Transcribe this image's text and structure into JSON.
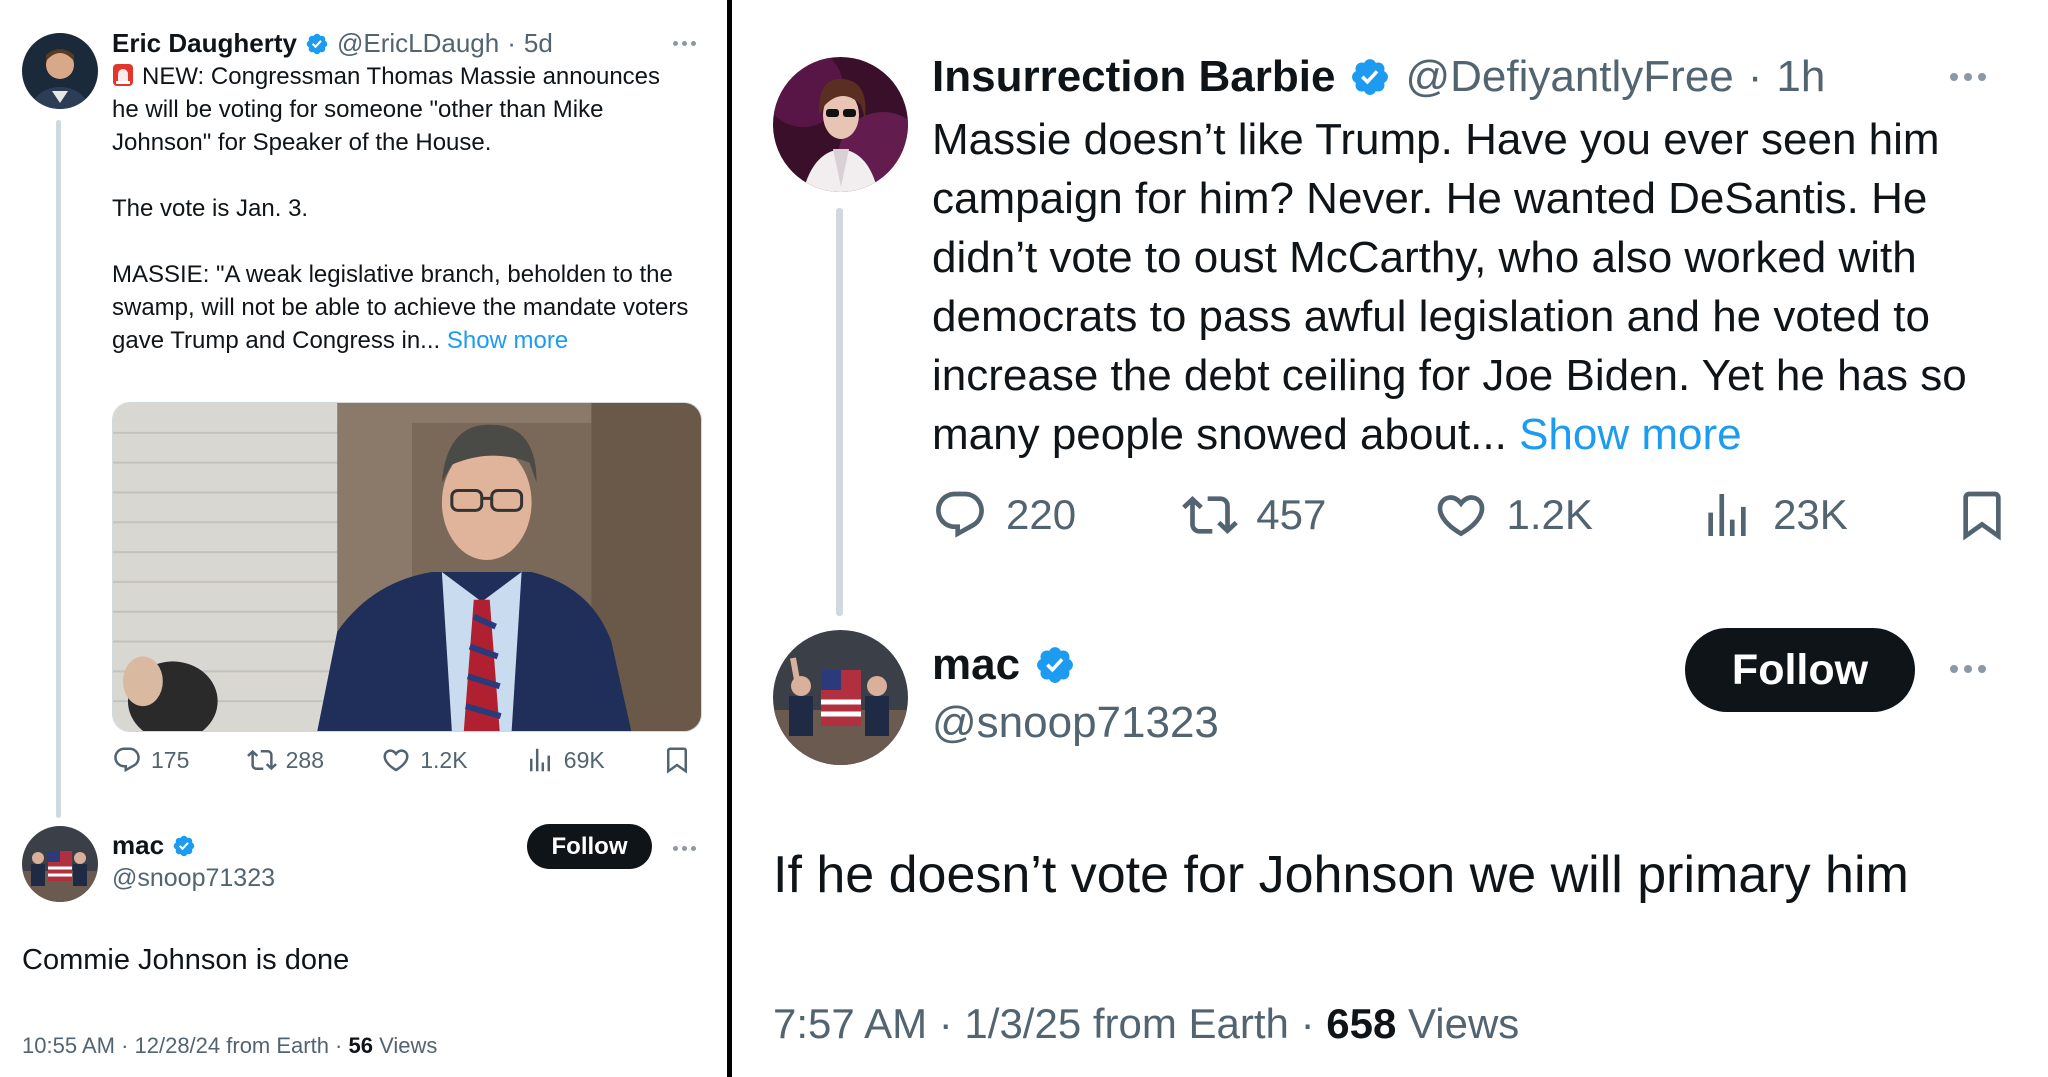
{
  "left": {
    "tweet": {
      "author_name": "Eric Daugherty",
      "author_handle": "@EricLDaugh",
      "time": "5d",
      "text_lines": [
        "NEW: Congressman Thomas Massie announces he will be voting for someone \"other than Mike Johnson\" for Speaker of the House.",
        "The vote is Jan. 3.",
        "MASSIE: \"A weak legislative branch, beholden to the swamp, will not be able to achieve the mandate voters gave Trump and Congress in..."
      ],
      "show_more": "Show more",
      "stats": {
        "replies": "175",
        "reposts": "288",
        "likes": "1.2K",
        "views": "69K"
      }
    },
    "reply": {
      "author_name": "mac",
      "author_handle": "@snoop71323",
      "follow_label": "Follow",
      "text": "Commie Johnson is done",
      "meta_prefix": "10:55 AM · 12/28/24 from Earth · ",
      "views_count": "56",
      "views_label": " Views"
    }
  },
  "right": {
    "tweet": {
      "author_name": "Insurrection Barbie",
      "author_handle": "@DefiyantlyFree",
      "time": "1h",
      "text": "Massie doesn’t like Trump. Have you ever seen him campaign for him? Never. He wanted DeSantis. He didn’t vote to oust McCarthy, who also worked with democrats to pass awful legislation and he voted to increase the debt ceiling for Joe Biden. Yet he has so many people snowed about...",
      "show_more": "Show more",
      "stats": {
        "replies": "220",
        "reposts": "457",
        "likes": "1.2K",
        "views": "23K"
      }
    },
    "reply": {
      "author_name": "mac",
      "author_handle": "@snoop71323",
      "follow_label": "Follow",
      "text": "If he doesn’t vote for Johnson we will primary him",
      "meta_prefix": "7:57 AM · 1/3/25 from Earth · ",
      "views_count": "658",
      "views_label": " Views"
    }
  },
  "colors": {
    "link": "#1d9bf0",
    "verified": "#1d9bf0",
    "muted_text": "#536471",
    "follow_bg": "#0f1419",
    "divider": "#000000"
  },
  "icons": [
    "reply-icon",
    "repost-icon",
    "like-icon",
    "views-icon",
    "bookmark-icon",
    "verified-badge-icon",
    "more-icon",
    "siren-icon"
  ]
}
